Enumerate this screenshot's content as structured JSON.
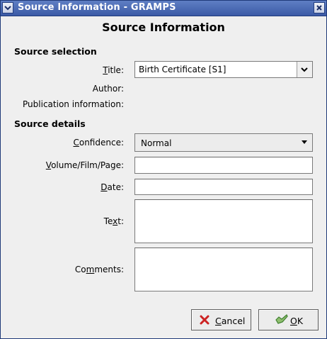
{
  "window": {
    "title": "Source Information - GRAMPS",
    "heading": "Source Information"
  },
  "source_selection": {
    "section_title": "Source selection",
    "title_label": "Title:",
    "title_value": "Birth Certificate [S1]",
    "author_label": "Author:",
    "author_value": "",
    "publication_label": "Publication information:",
    "publication_value": ""
  },
  "source_details": {
    "section_title": "Source details",
    "confidence_label": "Confidence:",
    "confidence_value": "Normal",
    "volume_label": "Volume/Film/Page:",
    "volume_value": "",
    "date_label": "Date:",
    "date_value": "",
    "text_label": "Text:",
    "text_value": "",
    "comments_label": "Comments:",
    "comments_value": ""
  },
  "buttons": {
    "cancel_label": "Cancel",
    "ok_label": "OK"
  },
  "colors": {
    "titlebar": "#4a6ab5",
    "window_bg": "#efefef",
    "cancel_icon": "#cc2222",
    "ok_icon": "#3f7f2f"
  },
  "icons": {
    "window_menu": "chevron-down-icon",
    "window_close": "close-icon",
    "cancel": "x-icon",
    "ok": "hand-check-icon"
  }
}
